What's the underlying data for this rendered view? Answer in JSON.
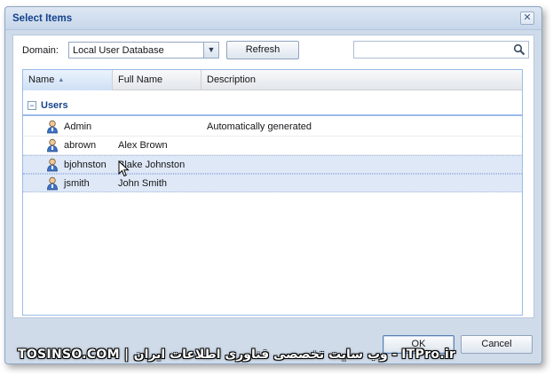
{
  "window": {
    "title": "Select Items",
    "close_glyph": "✕"
  },
  "toolbar": {
    "domain_label": "Domain:",
    "domain_value": "Local User Database",
    "dropdown_glyph": "▼",
    "refresh_label": "Refresh",
    "search_value": ""
  },
  "grid": {
    "columns": [
      "Name",
      "Full Name",
      "Description"
    ],
    "sort_glyph": "▲",
    "group": {
      "toggle_glyph": "−",
      "label": "Users"
    },
    "rows": [
      {
        "name": "Admin",
        "full_name": "",
        "description": "Automatically generated",
        "selected": false
      },
      {
        "name": "abrown",
        "full_name": "Alex Brown",
        "description": "",
        "selected": false
      },
      {
        "name": "bjohnston",
        "full_name": "Blake Johnston",
        "description": "",
        "selected": true
      },
      {
        "name": "jsmith",
        "full_name": "John Smith",
        "description": "",
        "selected": true
      }
    ]
  },
  "footer": {
    "ok_label": "OK",
    "cancel_label": "Cancel"
  },
  "watermark": "TOSINSO.COM | وب سایت تخصصی فناوری اطلاعات ایران - ITPro.ir",
  "icons": {
    "user": "user-icon",
    "search": "search-icon",
    "close": "close-icon",
    "cursor": "mouse-cursor-icon"
  },
  "colors": {
    "accent": "#15428b",
    "selection": "#dfe8f6",
    "frame": "#cfdbe9"
  }
}
